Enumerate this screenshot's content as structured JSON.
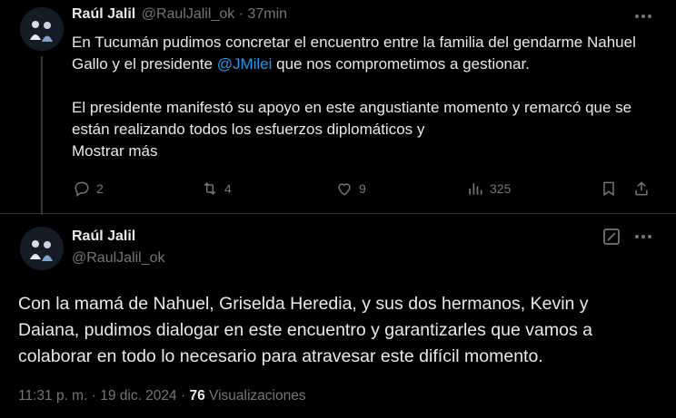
{
  "tweet1": {
    "author_name": "Raúl Jalil",
    "handle": "@RaulJalil_ok",
    "separator": "·",
    "time": "37min",
    "text_part1": "En Tucumán pudimos concretar el encuentro entre la familia del gendarme Nahuel Gallo y el presidente ",
    "mention": "@JMilei",
    "text_part2": " que nos comprometimos a gestionar.",
    "paragraph2": "El presidente manifestó su apoyo en este angustiante momento y remarcó que se están realizando todos los esfuerzos diplomáticos y",
    "show_more": "Mostrar más",
    "actions": {
      "replies": "2",
      "reposts": "4",
      "likes": "9",
      "views": "325"
    }
  },
  "tweet2": {
    "author_name": "Raúl Jalil",
    "handle": "@RaulJalil_ok",
    "text": "Con la mamá de Nahuel, Griselda Heredia, y sus dos hermanos, Kevin y Daiana, pudimos dialogar en este encuentro y garantizarles que vamos a colaborar en todo lo necesario para atravesar este difícil momento.",
    "time": "11:31 p. m.",
    "dot": "·",
    "date": "19 dic. 2024",
    "views_count": "76",
    "views_label": "Visualizaciones"
  },
  "icons": [
    "more-icon",
    "reply-icon",
    "repost-icon",
    "like-icon",
    "views-icon",
    "bookmark-icon",
    "share-icon",
    "grok-edit-icon"
  ]
}
